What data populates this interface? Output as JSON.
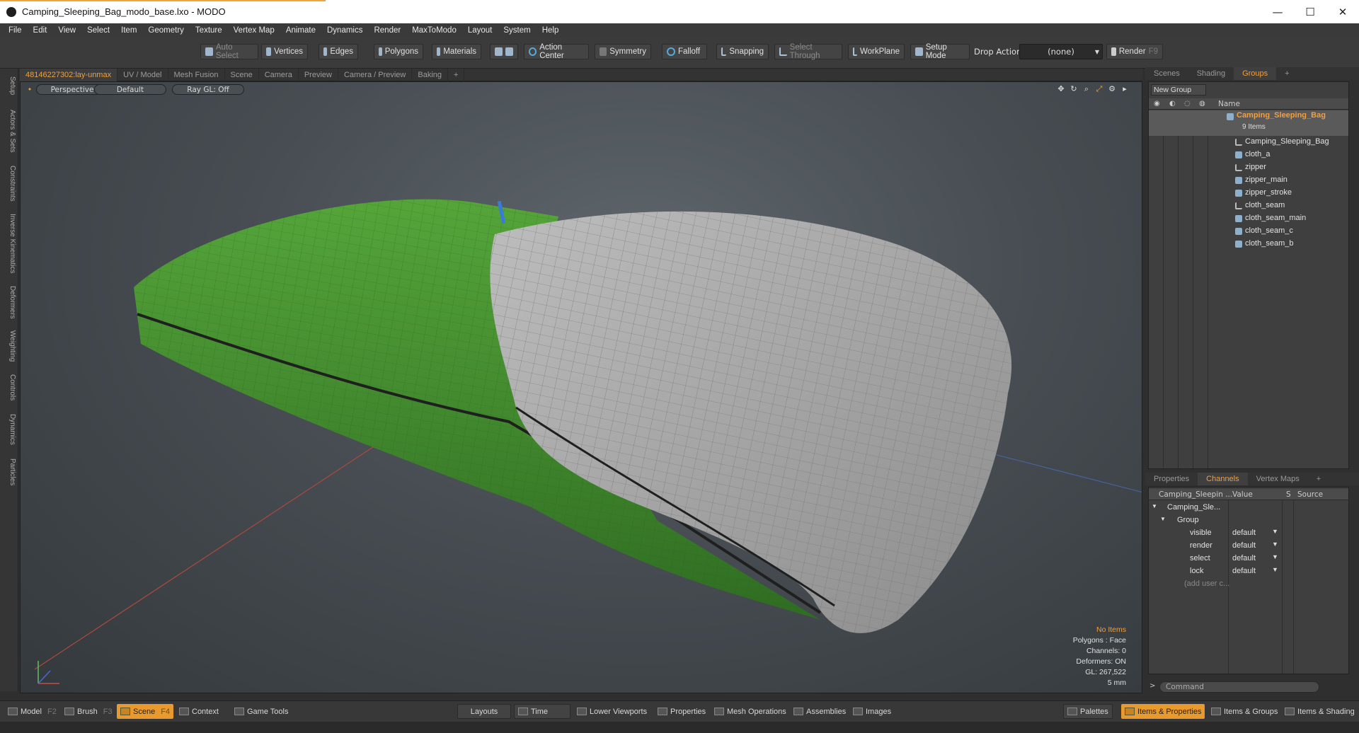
{
  "window": {
    "title": "Camping_Sleeping_Bag_modo_base.lxo - MODO",
    "minimize": "—",
    "maximize": "☐",
    "close": "✕"
  },
  "menu": [
    "File",
    "Edit",
    "View",
    "Select",
    "Item",
    "Geometry",
    "Texture",
    "Vertex Map",
    "Animate",
    "Dynamics",
    "Render",
    "MaxToModo",
    "Layout",
    "System",
    "Help"
  ],
  "toolbar": {
    "auto_select": "Auto Select",
    "vertices": "Vertices",
    "edges": "Edges",
    "polygons": "Polygons",
    "materials": "Materials",
    "action_center": "Action Center",
    "symmetry": "Symmetry",
    "falloff": "Falloff",
    "snapping": "Snapping",
    "select_through": "Select Through",
    "workplane": "WorkPlane",
    "setup_mode": "Setup Mode",
    "drop_action": "Drop Action",
    "drop_action_value": "(none)",
    "render": "Render",
    "render_key": "F9"
  },
  "left_tabs": [
    "Setup",
    "Actors & Sets",
    "Constraints",
    "Inverse Kinematics",
    "Deformers",
    "Weighting",
    "Controls",
    "Dynamics",
    "Particles"
  ],
  "viewport_tabs": [
    {
      "label": "48146227302:lay-unmax",
      "active": true
    },
    {
      "label": "UV / Model",
      "active": false
    },
    {
      "label": "Mesh Fusion",
      "active": false
    },
    {
      "label": "Scene",
      "active": false
    },
    {
      "label": "Camera",
      "active": false
    },
    {
      "label": "Preview",
      "active": false
    },
    {
      "label": "Camera / Preview",
      "active": false
    },
    {
      "label": "Baking",
      "active": false
    },
    {
      "label": "+",
      "active": false
    }
  ],
  "viewport": {
    "view": "Perspective",
    "shading": "Default",
    "raygl": "Ray GL: Off",
    "info": {
      "items": "No Items",
      "polygons": "Polygons : Face",
      "channels": "Channels: 0",
      "deformers": "Deformers: ON",
      "gl": "GL: 267,522",
      "unit": "5 mm"
    }
  },
  "right_tabs": [
    {
      "label": "Scenes",
      "active": false
    },
    {
      "label": "Shading",
      "active": false
    },
    {
      "label": "Groups",
      "active": true
    },
    {
      "label": "+",
      "active": false
    }
  ],
  "groups": {
    "new_group": "New Group",
    "name_header": "Name",
    "root": "Camping_Sleeping_Bag",
    "root_count": "9 Items",
    "items": [
      {
        "label": "Camping_Sleeping_Bag",
        "icon": "locator-icon"
      },
      {
        "label": "cloth_a",
        "icon": "mesh-icon"
      },
      {
        "label": "zipper",
        "icon": "locator-icon"
      },
      {
        "label": "zipper_main",
        "icon": "mesh-icon"
      },
      {
        "label": "zipper_stroke",
        "icon": "mesh-icon"
      },
      {
        "label": "cloth_seam",
        "icon": "locator-icon"
      },
      {
        "label": "cloth_seam_main",
        "icon": "mesh-icon"
      },
      {
        "label": "cloth_seam_c",
        "icon": "mesh-icon"
      },
      {
        "label": "cloth_seam_b",
        "icon": "mesh-icon"
      }
    ]
  },
  "prop_tabs": [
    {
      "label": "Properties",
      "active": false
    },
    {
      "label": "Channels",
      "active": true
    },
    {
      "label": "Vertex Maps",
      "active": false
    },
    {
      "label": "+",
      "active": false
    }
  ],
  "channels": {
    "header_name": "Camping_Sleepin ...",
    "header_value": "Value",
    "header_s": "S",
    "header_source": "Source",
    "item": "Camping_Sle...",
    "group": "Group",
    "rows": [
      {
        "name": "visible",
        "value": "default"
      },
      {
        "name": "render",
        "value": "default"
      },
      {
        "name": "select",
        "value": "default"
      },
      {
        "name": "lock",
        "value": "default"
      }
    ],
    "add_user": "(add user c..."
  },
  "command_placeholder": "Command",
  "bottom": {
    "model": "Model",
    "model_key": "F2",
    "brush": "Brush",
    "brush_key": "F3",
    "scene": "Scene",
    "scene_key": "F4",
    "context": "Context",
    "game_tools": "Game Tools",
    "layouts": "Layouts",
    "time": "Time",
    "lower_viewports": "Lower Viewports",
    "properties": "Properties",
    "mesh_operations": "Mesh Operations",
    "assemblies": "Assemblies",
    "images": "Images",
    "palettes": "Palettes",
    "items_properties": "Items & Properties",
    "items_groups": "Items & Groups",
    "items_shading": "Items & Shading"
  },
  "colors": {
    "accent": "#f0a040",
    "bag_green": "#3f8a2c",
    "inner_gray": "#a8a8a8"
  }
}
